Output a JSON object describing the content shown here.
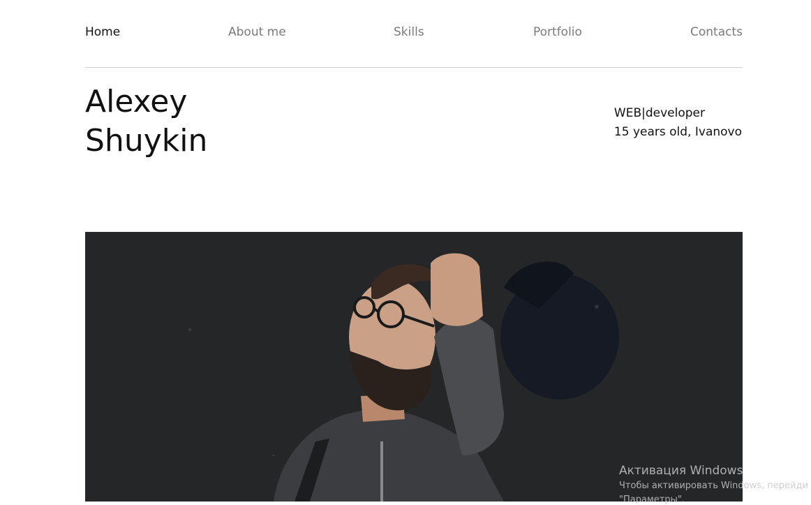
{
  "nav": {
    "items": [
      {
        "label": "Home",
        "active": true
      },
      {
        "label": "About me",
        "active": false
      },
      {
        "label": "Skills",
        "active": false
      },
      {
        "label": "Portfolio",
        "active": false
      },
      {
        "label": "Contacts",
        "active": false
      }
    ]
  },
  "header": {
    "first_name": "Alexey",
    "last_name": "Shuykin",
    "role": "WEB|developer",
    "details": "15 years old, Ivanovo"
  },
  "hero_image": {
    "subject": "man-with-glasses-and-cap-photo"
  },
  "os_watermark": {
    "title": "Активация Windows",
    "line1": "Чтобы активировать Windows, перейди",
    "line2": "\"Параметры\"."
  },
  "colors": {
    "text_primary": "#111111",
    "text_muted": "#7a7a7a",
    "divider": "#cfcfcf",
    "hero_bg": "#242526"
  }
}
